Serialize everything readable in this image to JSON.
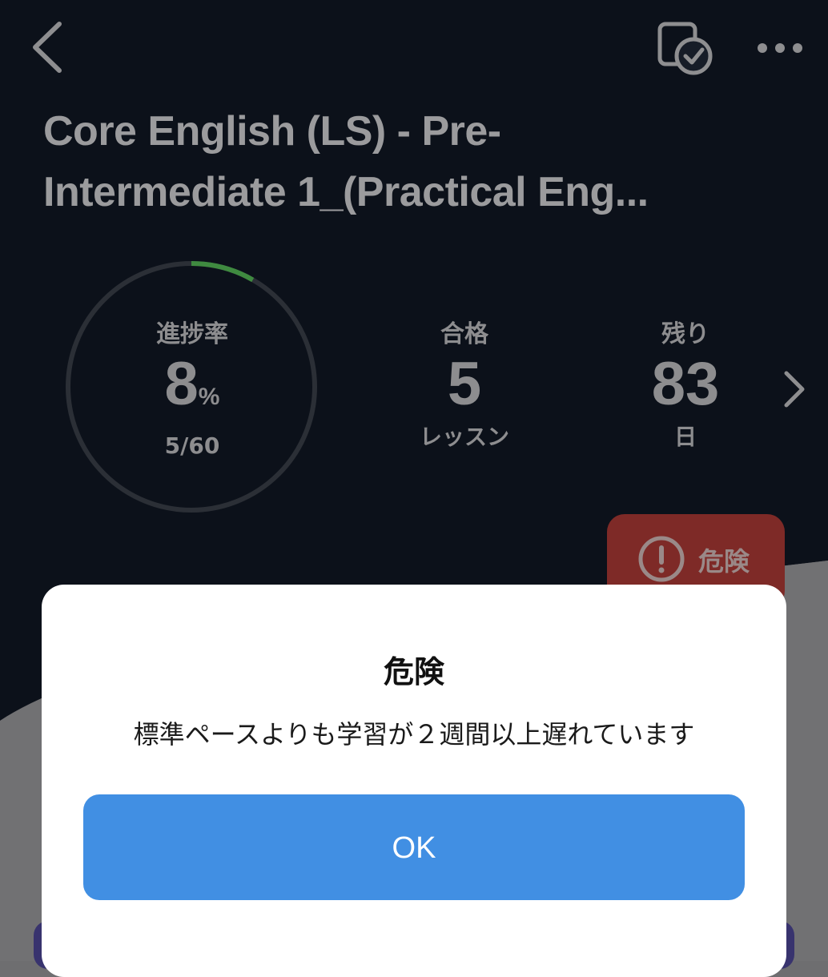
{
  "header": {
    "back_icon": "chevron-left-icon",
    "calendar_icon": "calendar-check-icon",
    "more_icon": "more-horizontal-icon",
    "title_line1": "Core English (LS) - Pre-",
    "title_line2": "Intermediate 1_(Practical Eng..."
  },
  "stats": {
    "progress": {
      "label": "進捗率",
      "value": "8",
      "unit": "%",
      "sub": "5/60",
      "fraction": 0.083
    },
    "passed": {
      "label": "合格",
      "value": "5",
      "unit": "レッスン"
    },
    "remaining": {
      "label": "残り",
      "value": "83",
      "unit": "日"
    }
  },
  "status_badge": {
    "label": "危険",
    "icon": "alert-circle-icon"
  },
  "dialog": {
    "title": "危険",
    "message": "標準ペースよりも学習が２週間以上遅れています",
    "ok_label": "OK"
  },
  "colors": {
    "header_bg": "#111a26",
    "progress_ring": "#3c8a3e",
    "danger": "#c8413c",
    "ok_button": "#418fe3",
    "dialog_bg": "#ffffff"
  }
}
